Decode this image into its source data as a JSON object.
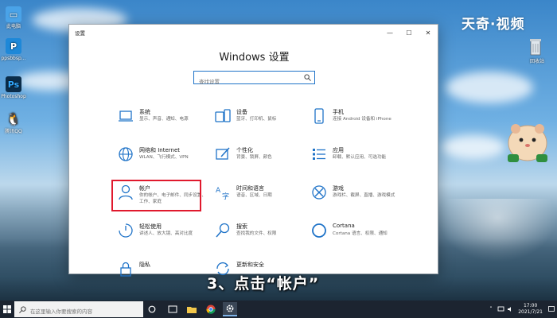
{
  "desktop": {
    "icons": [
      {
        "label": "此电脑"
      },
      {
        "label": "ppsbbsp..."
      },
      {
        "label": "Photoshop"
      },
      {
        "label": "腾讯QQ"
      }
    ],
    "recycle_label": "回收站",
    "watermark": "天奇·视频"
  },
  "settings_window": {
    "title": "设置",
    "heading": "Windows 设置",
    "search": {
      "placeholder": "查找设置",
      "value": ""
    },
    "categories": [
      {
        "name": "系统",
        "desc": "显示、声音、通知、电源",
        "icon": "laptop-icon"
      },
      {
        "name": "设备",
        "desc": "蓝牙、打印机、鼠标",
        "icon": "devices-icon"
      },
      {
        "name": "手机",
        "desc": "连接 Android 设备和 iPhone",
        "icon": "phone-icon"
      },
      {
        "name": "网络和 Internet",
        "desc": "WLAN、飞行模式、VPN",
        "icon": "globe-icon"
      },
      {
        "name": "个性化",
        "desc": "背景、锁屏、颜色",
        "icon": "paint-icon"
      },
      {
        "name": "应用",
        "desc": "卸载、默认应用、可选功能",
        "icon": "apps-icon"
      },
      {
        "name": "帐户",
        "desc": "你的帐户、电子邮件、同步设置、工作、家庭",
        "icon": "person-icon"
      },
      {
        "name": "时间和语言",
        "desc": "语音、区域、日期",
        "icon": "time-language-icon"
      },
      {
        "name": "游戏",
        "desc": "游戏栏、截屏、直播、游戏模式",
        "icon": "xbox-icon"
      },
      {
        "name": "轻松使用",
        "desc": "讲述人、放大镜、高对比度",
        "icon": "ease-of-access-icon"
      },
      {
        "name": "搜索",
        "desc": "查找我的文件、权限",
        "icon": "search-icon"
      },
      {
        "name": "Cortana",
        "desc": "Cortana 语言、权限、通知",
        "icon": "cortana-icon"
      },
      {
        "name": "隐私",
        "desc": "",
        "icon": "lock-icon"
      },
      {
        "name": "更新和安全",
        "desc": "",
        "icon": "update-icon"
      }
    ]
  },
  "subtitle": "3、点击“帐户”",
  "taskbar": {
    "search_placeholder": "在这里输入你要搜索的内容",
    "time": "17:00",
    "date": "2021/7/21"
  },
  "colors": {
    "accent": "#1f73c8",
    "highlight_box": "#e0192d",
    "taskbar": "#1c2430"
  }
}
